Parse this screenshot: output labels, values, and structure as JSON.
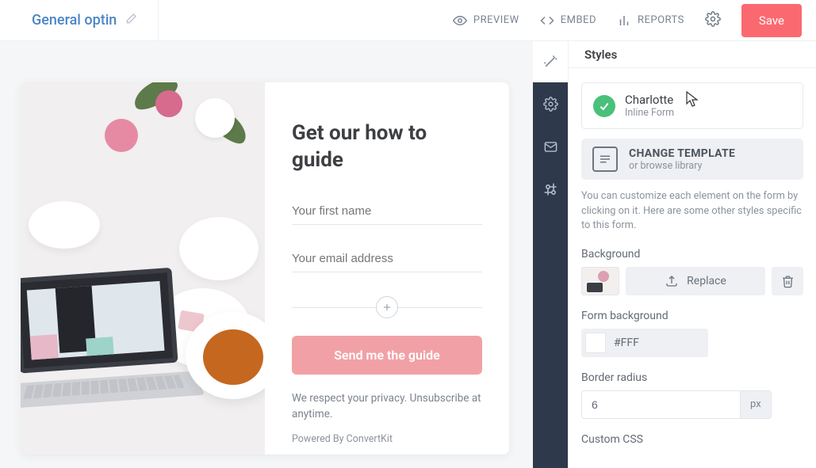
{
  "header": {
    "title": "General optin",
    "actions": {
      "preview": "PREVIEW",
      "embed": "EMBED",
      "reports": "REPORTS",
      "save": "Save"
    }
  },
  "form": {
    "heading": "Get our how to guide",
    "field_name_placeholder": "Your first name",
    "field_email_placeholder": "Your email address",
    "submit": "Send me the guide",
    "note": "We respect your privacy. Unsubscribe at anytime.",
    "powered": "Powered By ConvertKit"
  },
  "panel": {
    "title": "Styles",
    "template": {
      "name": "Charlotte",
      "type": "Inline Form"
    },
    "change": {
      "title": "CHANGE TEMPLATE",
      "sub": "or browse library"
    },
    "hint": "You can customize each element on the form by clicking on it. Here are some other styles specific to this form.",
    "background_label": "Background",
    "replace": "Replace",
    "form_bg_label": "Form background",
    "form_bg_value": "#FFF",
    "radius_label": "Border radius",
    "radius_value": "6",
    "radius_unit": "px",
    "css_label": "Custom CSS"
  }
}
